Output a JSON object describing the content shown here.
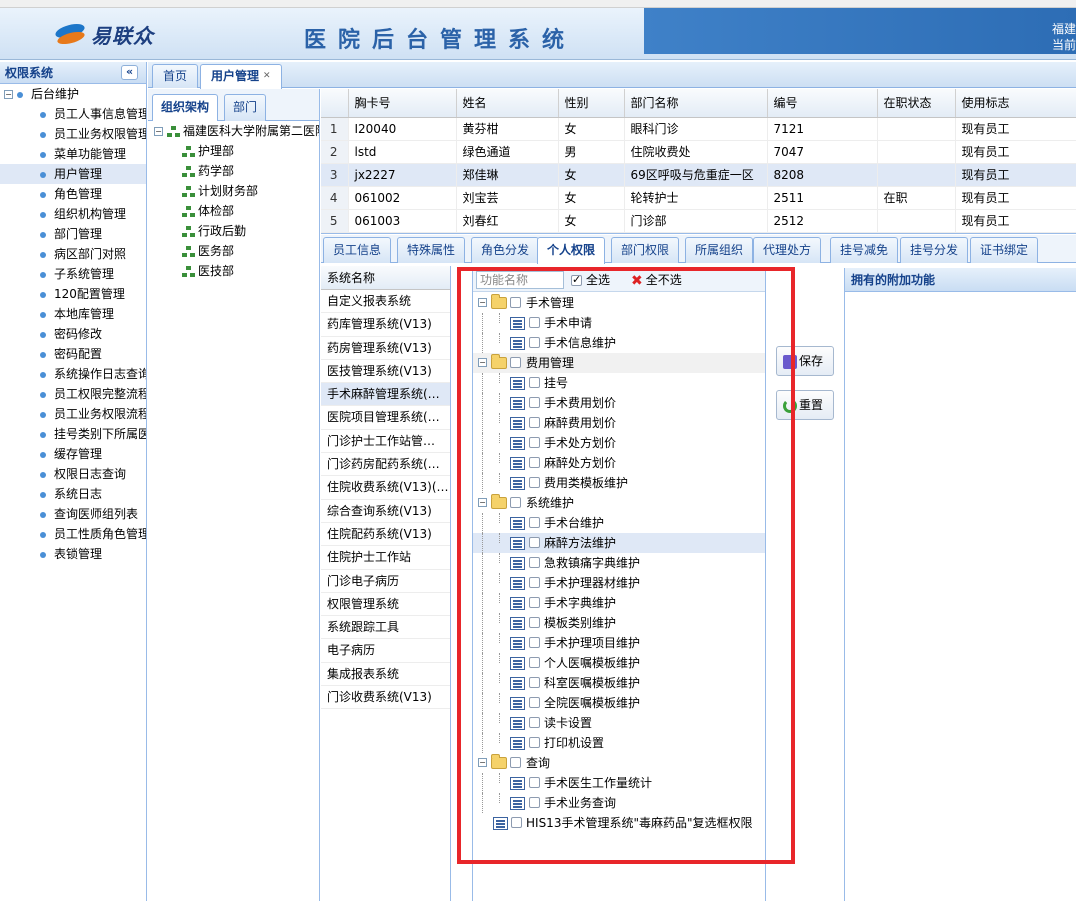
{
  "header": {
    "logo_text": "易联众",
    "system_title": "医院后台管理系统",
    "right_line1": "福建",
    "right_line2": "当前"
  },
  "left_panel": {
    "title": "权限系统",
    "collapse_glyph": "«",
    "root": "后台维护",
    "items": [
      "员工人事信息管理",
      "员工业务权限管理",
      "菜单功能管理",
      "用户管理",
      "角色管理",
      "组织机构管理",
      "部门管理",
      "病区部门对照",
      "子系统管理",
      "120配置管理",
      "本地库管理",
      "密码修改",
      "密码配置",
      "系统操作日志查询",
      "员工权限完整流程",
      "员工业务权限流程",
      "挂号类别下所属医生",
      "缓存管理",
      "权限日志查询",
      "系统日志",
      "查询医师组列表",
      "员工性质角色管理",
      "表锁管理"
    ],
    "selected_index": 3
  },
  "main_tabs": [
    {
      "label": "首页"
    },
    {
      "label": "用户管理",
      "close": "✕"
    }
  ],
  "org_panel": {
    "tabs": [
      "组织架构",
      "部门"
    ],
    "root": "福建医科大学附属第二医院",
    "children": [
      "护理部",
      "药学部",
      "计划财务部",
      "体检部",
      "行政后勤",
      "医务部",
      "医技部"
    ]
  },
  "grid": {
    "columns": [
      "胸卡号",
      "姓名",
      "性别",
      "部门名称",
      "编号",
      "在职状态",
      "使用标志"
    ],
    "rows": [
      [
        "1",
        "I20040",
        "黄芬柑",
        "女",
        "眼科门诊",
        "7121",
        "",
        "现有员工"
      ],
      [
        "2",
        "lstd",
        "绿色通道",
        "男",
        "住院收费处",
        "7047",
        "",
        "现有员工"
      ],
      [
        "3",
        "jx2227",
        "郑佳琳",
        "女",
        "69区呼吸与危重症一区",
        "8208",
        "",
        "现有员工"
      ],
      [
        "4",
        "061002",
        "刘宝芸",
        "女",
        "轮转护士",
        "2511",
        "在职",
        "现有员工"
      ],
      [
        "5",
        "061003",
        "刘春红",
        "女",
        "门诊部",
        "2512",
        "",
        "现有员工"
      ]
    ],
    "selected_row": 2
  },
  "lower_tabs": [
    "员工信息",
    "特殊属性",
    "角色分发",
    "个人权限",
    "部门权限",
    "所属组织",
    "代理处方",
    "挂号减免",
    "挂号分发",
    "证书绑定"
  ],
  "lower_tab_active": 3,
  "system_list": {
    "header": "系统名称",
    "items": [
      "自定义报表系统",
      "药库管理系统(V13)",
      "药房管理系统(V13)",
      "医技管理系统(V13)",
      "手术麻醉管理系统(…",
      "医院项目管理系统(…",
      "门诊护士工作站管…",
      "门诊药房配药系统(…",
      "住院收费系统(V13)(…",
      "综合查询系统(V13)",
      "住院配药系统(V13)",
      "住院护士工作站",
      "门诊电子病历",
      "权限管理系统",
      "系统跟踪工具",
      "电子病历",
      "集成报表系统",
      "门诊收费系统(V13)"
    ],
    "selected_index": 4
  },
  "function_panel": {
    "search_placeholder": "功能名称",
    "select_all": "全选",
    "select_none": "全不选",
    "tree": [
      {
        "label": "手术管理",
        "type": "group",
        "children": [
          "手术申请",
          "手术信息维护"
        ]
      },
      {
        "label": "费用管理",
        "type": "group",
        "children": [
          "挂号",
          "手术费用划价",
          "麻醉费用划价",
          "手术处方划价",
          "麻醉处方划价",
          "费用类模板维护"
        ]
      },
      {
        "label": "系统维护",
        "type": "group",
        "children": [
          "手术台维护",
          "麻醉方法维护",
          "急救镇痛字典维护",
          "手术护理器材维护",
          "手术字典维护",
          "模板类别维护",
          "手术护理项目维护",
          "个人医嘱模板维护",
          "科室医嘱模板维护",
          "全院医嘱模板维护",
          "读卡设置",
          "打印机设置"
        ]
      },
      {
        "label": "查询",
        "type": "group",
        "children": [
          "手术医生工作量统计",
          "手术业务查询"
        ]
      },
      {
        "label": "HIS13手术管理系统\"毒麻药品\"复选框权限",
        "type": "leaf"
      }
    ]
  },
  "buttons": {
    "save": "保存",
    "reset": "重置"
  },
  "extra_panel": {
    "title": "拥有的附加功能"
  },
  "colors": {
    "accent": "#15428b",
    "highlight_box": "#e8262a",
    "selection": "#dfe8f6"
  }
}
